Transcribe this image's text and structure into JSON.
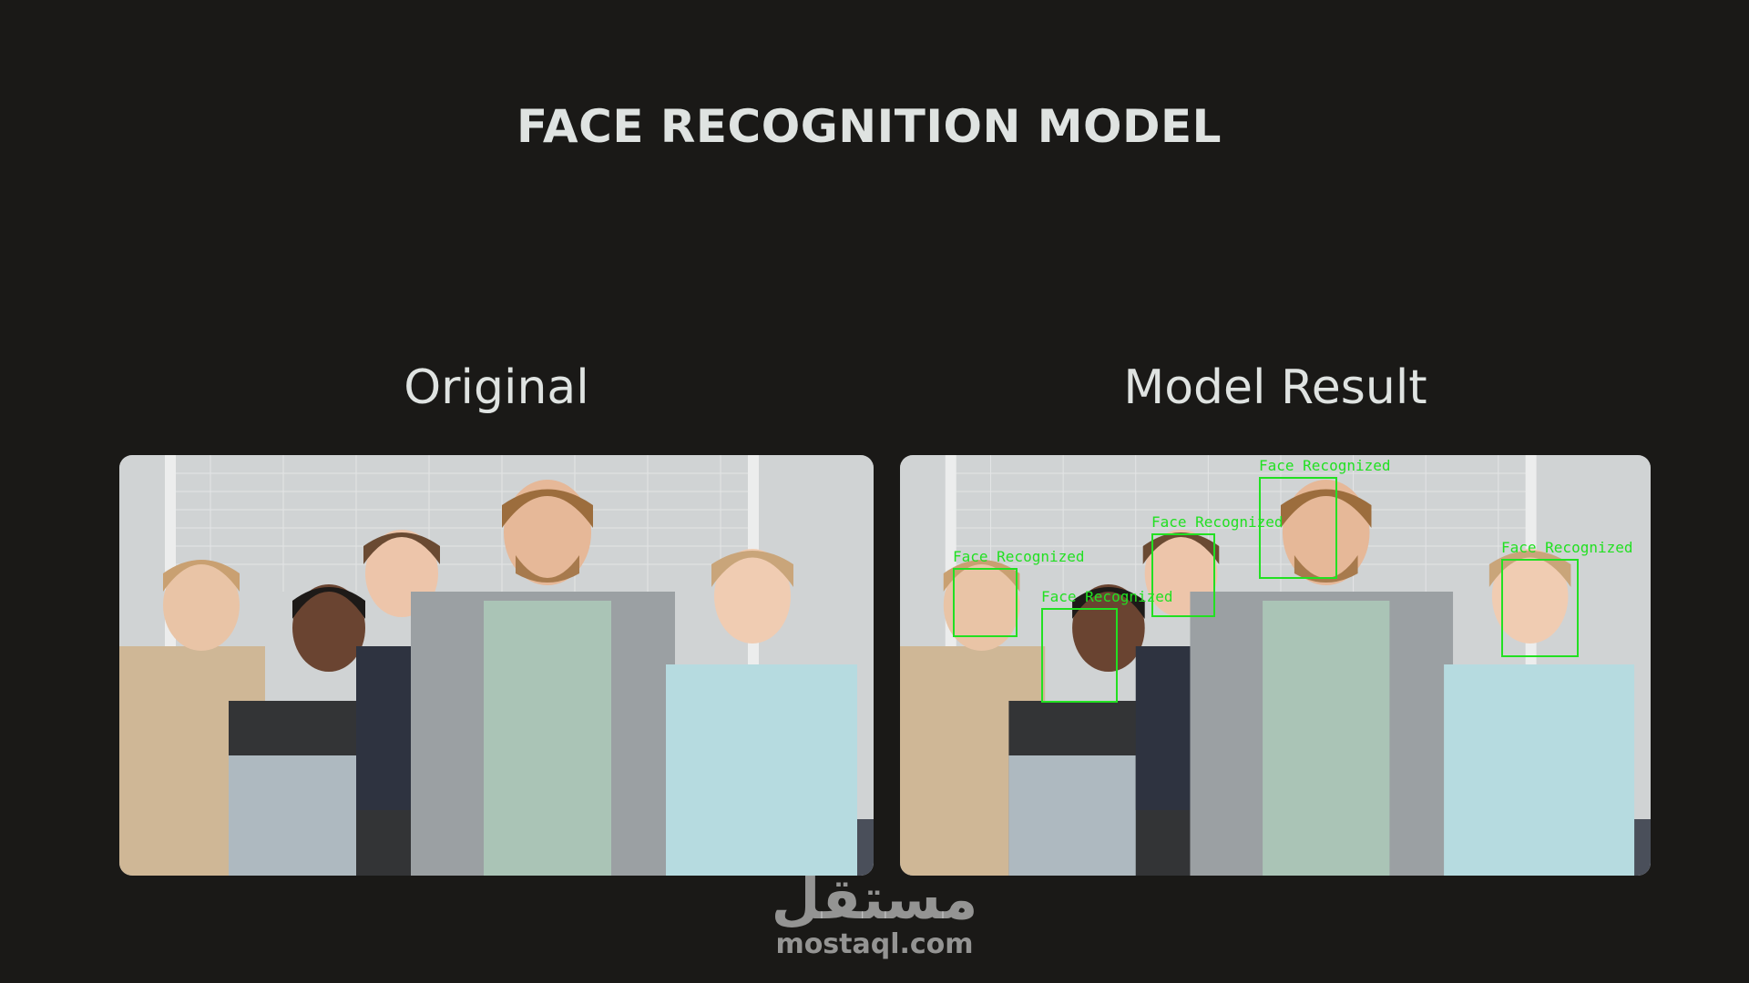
{
  "title": "FACE RECOGNITION MODEL",
  "panels": {
    "left_label": "Original",
    "right_label": "Model Result"
  },
  "detection": {
    "label": "Face Recognized",
    "box_color": "#22e022",
    "count": 5
  },
  "watermark": {
    "logo_text": "مستقل",
    "url": "mostaql.com"
  },
  "colors": {
    "background": "#1a1917",
    "text": "#dfe3e1"
  }
}
